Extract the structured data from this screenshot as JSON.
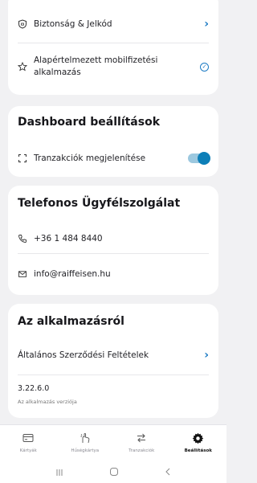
{
  "security_card": {
    "items": [
      {
        "label": "Biztonság & Jelkód",
        "icon": "shield-icon"
      },
      {
        "label": "Alapértelmezett mobilfizetési alkalmazás",
        "icon": "star-icon"
      }
    ]
  },
  "dashboard_card": {
    "title": "Dashboard beállítások",
    "toggle_label": "Tranzakciók megjelenítése",
    "toggle_on": true
  },
  "phone_card": {
    "title": "Telefonos Ügyfélszolgálat",
    "phone": "+36 1 484 8440",
    "email": "info@raiffeisen.hu"
  },
  "about_card": {
    "title": "Az alkalmazásról",
    "terms_label": "Általános Szerződési Feltételek",
    "version": "3.22.6.0",
    "version_caption": "Az alkalmazás verziója"
  },
  "nav": {
    "items": [
      {
        "label": "Kártyák",
        "icon": "card-icon"
      },
      {
        "label": "Hűségkártya",
        "icon": "loyalty-icon"
      },
      {
        "label": "Tranzakciók",
        "icon": "transfer-icon"
      },
      {
        "label": "Beállítások",
        "icon": "gear-icon"
      }
    ],
    "active_index": 3
  },
  "colors": {
    "accent": "#1d7bc4",
    "toggle": "#0d7fb8",
    "background": "#f1f1f3"
  }
}
